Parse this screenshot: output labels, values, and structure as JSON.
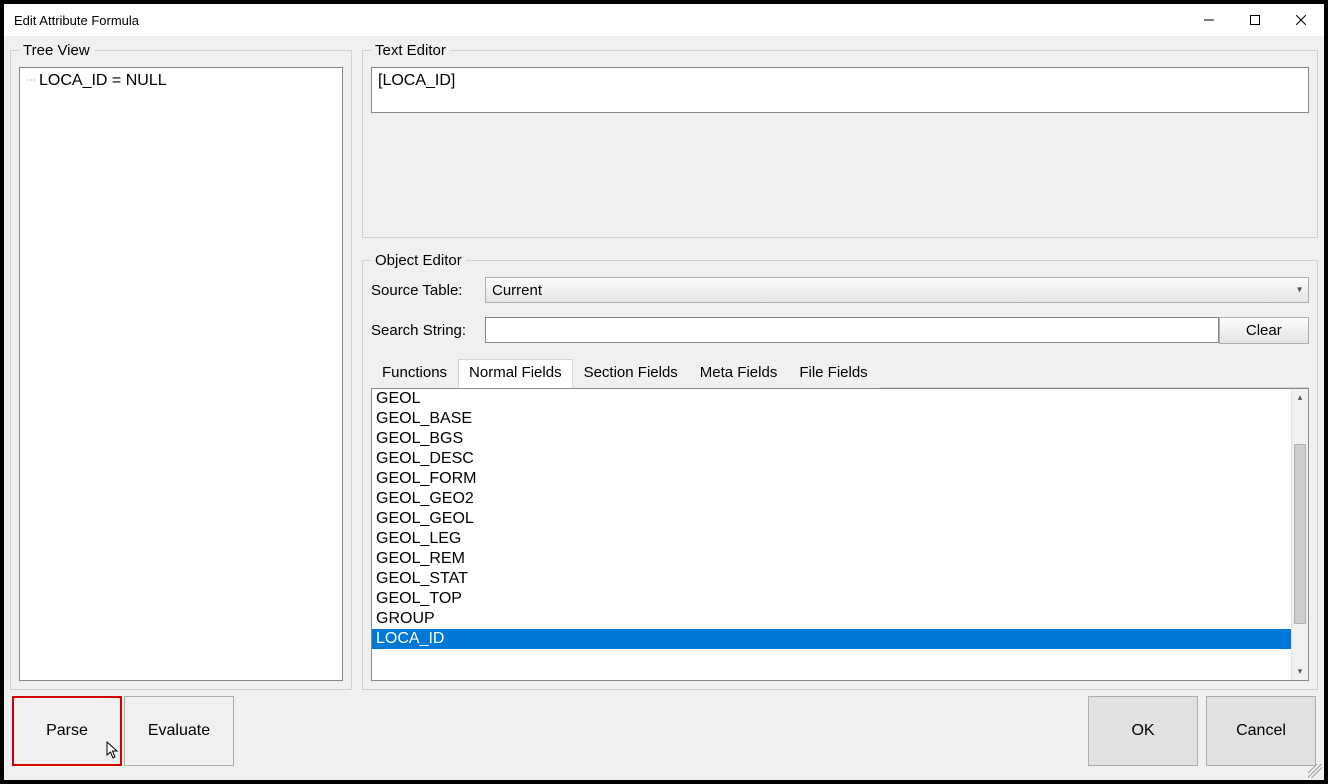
{
  "window": {
    "title": "Edit Attribute Formula"
  },
  "tree": {
    "legend": "Tree View",
    "items": [
      "LOCA_ID = NULL"
    ]
  },
  "textEditor": {
    "legend": "Text Editor",
    "value": "[LOCA_ID]"
  },
  "objectEditor": {
    "legend": "Object Editor",
    "sourceTableLabel": "Source Table:",
    "sourceTableValue": "Current",
    "searchLabel": "Search String:",
    "searchValue": "",
    "clearLabel": "Clear",
    "tabs": [
      "Functions",
      "Normal Fields",
      "Section Fields",
      "Meta Fields",
      "File Fields"
    ],
    "activeTabIndex": 1,
    "fields": [
      "GEOL",
      "GEOL_BASE",
      "GEOL_BGS",
      "GEOL_DESC",
      "GEOL_FORM",
      "GEOL_GEO2",
      "GEOL_GEOL",
      "GEOL_LEG",
      "GEOL_REM",
      "GEOL_STAT",
      "GEOL_TOP",
      "GROUP",
      "LOCA_ID"
    ],
    "selectedFieldIndex": 12
  },
  "footer": {
    "parse": "Parse",
    "evaluate": "Evaluate",
    "ok": "OK",
    "cancel": "Cancel"
  }
}
